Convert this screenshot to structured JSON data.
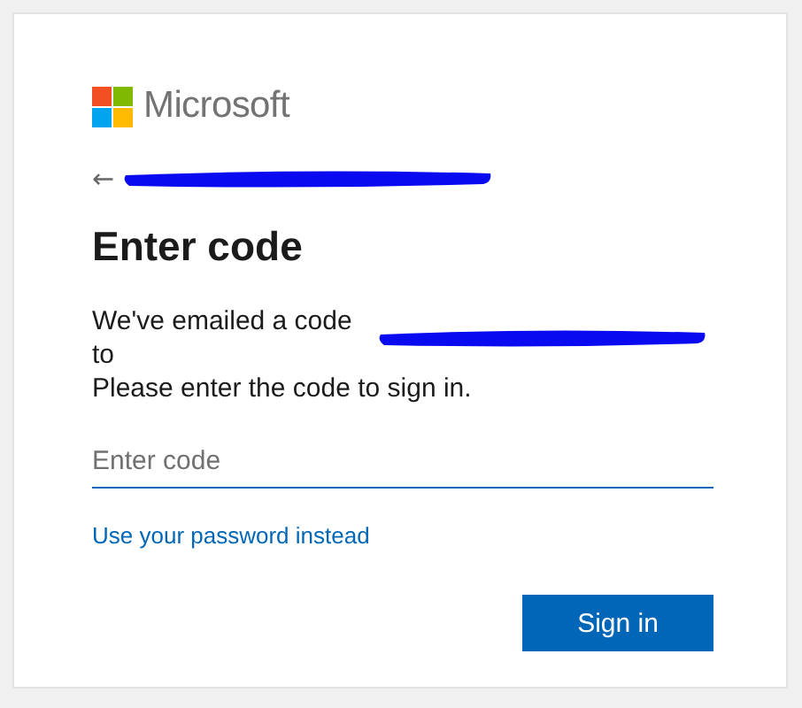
{
  "brand": {
    "name": "Microsoft"
  },
  "back": {
    "icon": "←"
  },
  "title": "Enter code",
  "message": [
    "We've emailed a code to",
    "Please enter the code to sign in."
  ],
  "code_field": {
    "placeholder": "Enter code"
  },
  "alt_link": "Use your password instead",
  "buttons": [
    {
      "label": "Sign in",
      "kind": "primary"
    }
  ]
}
